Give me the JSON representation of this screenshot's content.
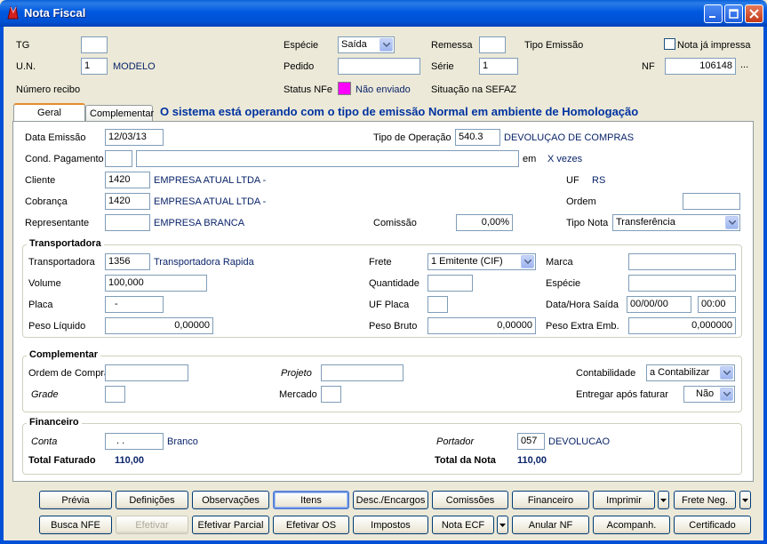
{
  "window": {
    "title": "Nota Fiscal"
  },
  "header": {
    "tg_label": "TG",
    "tg_value": "",
    "un_label": "U.N.",
    "un_value": "1",
    "un_name": "MODELO",
    "numero_recibo_label": "Número recibo",
    "especie_label": "Espécie",
    "especie_value": "Saída",
    "pedido_label": "Pedido",
    "pedido_value": "",
    "status_nfe_label": "Status NFe",
    "status_nfe_value": "Não enviado",
    "remessa_label": "Remessa",
    "remessa_value": "",
    "serie_label": "Série",
    "serie_value": "1",
    "situacao_sefaz_label": "Situação na SEFAZ",
    "tipo_emissao_label": "Tipo Emissão",
    "nota_impressa_label": "Nota já impressa",
    "nf_label": "NF",
    "nf_value": "106148",
    "nf_lookup": "...",
    "status_color": "#ff00ff"
  },
  "tabs": [
    {
      "label": "Geral"
    },
    {
      "label": "Complementar"
    }
  ],
  "banner": "O sistema está operando com o tipo de emissão Normal em ambiente de Homologação",
  "geral": {
    "data_emissao_label": "Data Emissão",
    "data_emissao_value": "12/03/13",
    "tipo_operacao_label": "Tipo de Operação",
    "tipo_operacao_value": "540.3",
    "tipo_operacao_desc": "DEVOLUÇAO DE COMPRAS",
    "cond_pagamento_label": "Cond. Pagamento",
    "cond_code": "",
    "cond_desc": "",
    "em_label": "em",
    "vezes_label": "X  vezes",
    "cliente_label": "Cliente",
    "cliente_code": "1420",
    "cliente_name": "EMPRESA ATUAL LTDA -",
    "uf_label": "UF",
    "uf_value": "RS",
    "cobranca_label": "Cobrança",
    "cobranca_code": "1420",
    "cobranca_name": "EMPRESA ATUAL LTDA -",
    "ordem_label": "Ordem",
    "ordem_value": "",
    "representante_label": "Representante",
    "representante_code": "",
    "representante_name": "EMPRESA BRANCA",
    "comissao_label": "Comissão",
    "comissao_value": "0,00%",
    "tipo_nota_label": "Tipo Nota",
    "tipo_nota_value": "Transferência"
  },
  "transportadora": {
    "title": "Transportadora",
    "transportadora_label": "Transportadora",
    "transportadora_code": "1356",
    "transportadora_name": "Transportadora Rapida",
    "frete_label": "Frete",
    "frete_value": "1 Emitente (CIF)",
    "marca_label": "Marca",
    "marca_value": "",
    "volume_label": "Volume",
    "volume_value": "100,000",
    "quantidade_label": "Quantidade",
    "quantidade_value": "",
    "especie_label": "Espécie",
    "especie_value": "",
    "placa_label": "Placa",
    "placa_value": "-",
    "uf_placa_label": "UF Placa",
    "uf_placa_value": "",
    "data_hora_saida_label": "Data/Hora Saída",
    "data_saida_value": "00/00/00",
    "hora_saida_value": "00:00",
    "peso_liquido_label": "Peso Líquido",
    "peso_liquido_value": "0,00000",
    "peso_bruto_label": "Peso Bruto",
    "peso_bruto_value": "0,00000",
    "peso_extra_label": "Peso Extra Emb.",
    "peso_extra_value": "0,000000"
  },
  "complementar": {
    "title": "Complementar",
    "ordem_compra_label": "Ordem de Compra",
    "ordem_compra_value": "",
    "projeto_label": "Projeto",
    "projeto_value": "",
    "contabilidade_label": "Contabilidade",
    "contabilidade_value": "a Contabilizar",
    "grade_label": "Grade",
    "grade_value": "",
    "mercado_label": "Mercado",
    "mercado_value": "",
    "entregar_label": "Entregar após faturar",
    "entregar_value": "Não"
  },
  "financeiro": {
    "title": "Financeiro",
    "conta_label": "Conta",
    "conta_value": " .  .",
    "conta_name": "Branco",
    "portador_label": "Portador",
    "portador_value": "057",
    "portador_name": "DEVOLUCAO",
    "total_faturado_label": "Total Faturado",
    "total_faturado_value": "110,00",
    "total_nota_label": "Total da Nota",
    "total_nota_value": "110,00"
  },
  "buttons": {
    "previa": "Prévia",
    "definicoes": "Definições",
    "observacoes": "Observações",
    "itens": "Itens",
    "desc_encargos": "Desc./Encargos",
    "comissoes": "Comissões",
    "financeiro": "Financeiro",
    "imprimir": "Imprimir",
    "frete_neg": "Frete Neg.",
    "busca_nfe": "Busca NFE",
    "efetivar": "Efetivar",
    "efetivar_parcial": "Efetivar Parcial",
    "efetivar_os": "Efetivar OS",
    "impostos": "Impostos",
    "nota_ecf": "Nota ECF",
    "anular_nf": "Anular NF",
    "acompanh": "Acompanh.",
    "certificado": "Certificado"
  }
}
